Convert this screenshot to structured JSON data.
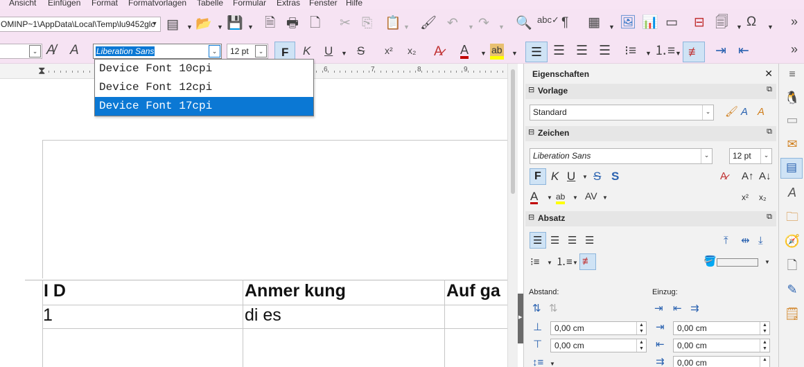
{
  "menu": [
    "Ansicht",
    "Einfügen",
    "Format",
    "Formatvorlagen",
    "Tabelle",
    "Formular",
    "Extras",
    "Fenster",
    "Hilfe"
  ],
  "toolbar": {
    "path": "OMINP~1\\AppData\\Local\\Temp\\lu9452glc",
    "font_name": "Liberation Sans",
    "font_size": "12 pt",
    "bold": "F",
    "italic": "K",
    "underline": "U",
    "strike": "S",
    "superscript": "x²",
    "subscript": "x₂",
    "overflow": "»"
  },
  "font_dropdown": {
    "items": [
      "Device Font 10cpi",
      "Device Font 12cpi",
      "Device Font 17cpi"
    ],
    "selected_index": 2
  },
  "ruler": {
    "numbers": [
      "6",
      "7",
      "8",
      "9"
    ]
  },
  "document": {
    "headers": [
      "I D",
      "Anmer kung",
      "Auf ga"
    ],
    "row1": [
      "1",
      "di es",
      ""
    ]
  },
  "sidebar": {
    "title": "Eigenschaften",
    "panels": {
      "vorlage": {
        "title": "Vorlage",
        "value": "Standard"
      },
      "zeichen": {
        "title": "Zeichen",
        "font": "Liberation Sans",
        "size": "12 pt",
        "bold": "F",
        "italic": "K",
        "underline": "U",
        "strike": "S",
        "shadow": "S"
      },
      "absatz": {
        "title": "Absatz",
        "abstand_label": "Abstand:",
        "einzug_label": "Einzug:",
        "spacing": [
          "0,00 cm",
          "0,00 cm"
        ],
        "indent": [
          "0,00 cm",
          "0,00 cm",
          "0,00 cm"
        ]
      }
    }
  },
  "colors": {
    "accent": "#0b78d4",
    "toolbar_bg": "#f6e3f3",
    "font_color": "#c00000",
    "highlight": "#ffff00"
  }
}
